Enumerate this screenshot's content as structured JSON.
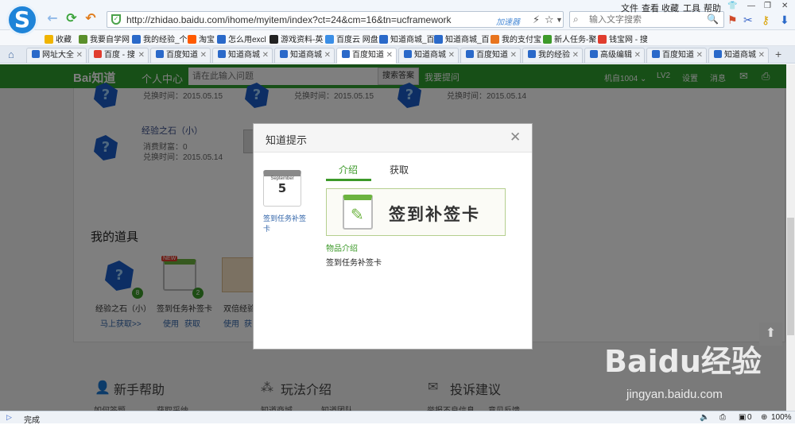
{
  "browser": {
    "logo_letter": "S",
    "url": "http://zhidao.baidu.com/ihome/myitem/index?ct=24&cm=16&tn=ucframework",
    "accelerator": "加速器",
    "search_placeholder": "输入文字搜索",
    "menu": [
      "文件",
      "查看",
      "收藏",
      "工具",
      "帮助"
    ],
    "status_left": "完成",
    "status_right": "100%",
    "status_count": "0"
  },
  "bookmarks": [
    {
      "label": "收藏",
      "color": "#f0b400"
    },
    {
      "label": "我要自学网",
      "color": "#5a8f2b"
    },
    {
      "label": "我的经验_个",
      "color": "#2a69c9"
    },
    {
      "label": "淘宝",
      "color": "#ff5a00"
    },
    {
      "label": "怎么用excl",
      "color": "#2a69c9"
    },
    {
      "label": "游戏资料-英",
      "color": "#222222"
    },
    {
      "label": "百度云 网盘",
      "color": "#3a8ee6"
    },
    {
      "label": "知道商城_百",
      "color": "#2a69c9"
    },
    {
      "label": "知道商城_百",
      "color": "#2a69c9"
    },
    {
      "label": "我的支付宝",
      "color": "#e8741e"
    },
    {
      "label": "新人任务-聚",
      "color": "#3d9a2a"
    },
    {
      "label": "钱宝网 - 搜",
      "color": "#e03c2e"
    }
  ],
  "tabs": [
    "网址大全",
    "百度 - 搜",
    "百度知道",
    "知道商城",
    "知道商城",
    "百度知道",
    "知道商城",
    "百度知道",
    "我的经验",
    "高级编辑",
    "百度知道",
    "知道商城"
  ],
  "site": {
    "brand": "Bai知道",
    "user_center": "个人中心",
    "search_placeholder": "请在此输入问题",
    "search_button": "搜索答案",
    "ask": "我要提问",
    "user": "机自1004",
    "level": "LV2",
    "settings": "设置",
    "messages": "消息"
  },
  "page": {
    "redeem_label": "兑换时间：2015.05.15",
    "redeem_label_2": "兑换时间：2015.05.15",
    "redeem_label_3": "兑换时间：2015.05.14",
    "item_title": "经验之石（小）",
    "item_cost": "消费财富：0",
    "item_time": "兑换时间：2015.05.14",
    "my_props": "我的道具",
    "props": [
      {
        "name": "经验之石（小）",
        "count": "8",
        "links": [
          "马上获取>>"
        ]
      },
      {
        "name": "签到任务补签卡",
        "count": "2",
        "links": [
          "使用",
          "获取"
        ]
      },
      {
        "name": "双倍经验卡",
        "count": "",
        "links": [
          "使用",
          "获"
        ]
      }
    ],
    "footer": [
      {
        "title": "新手帮助",
        "links": [
          "如何答题",
          "获取采纳"
        ]
      },
      {
        "title": "玩法介绍",
        "links": [
          "知道商城",
          "知道团队"
        ]
      },
      {
        "title": "投诉建议",
        "links": [
          "举报不良信息",
          "意见反馈"
        ]
      }
    ]
  },
  "dialog": {
    "title": "知道提示",
    "tabs": [
      "介绍",
      "获取"
    ],
    "active_tab": "介绍",
    "item_thumb_caption": "签到任务补签卡",
    "card_title": "签到补签卡",
    "desc_heading": "物品介绍",
    "desc_text": "签到任务补签卡",
    "calendar_month": "September",
    "calendar_day": "5"
  },
  "watermark": {
    "brand": "Baidu经验",
    "url": "jingyan.baidu.com"
  }
}
